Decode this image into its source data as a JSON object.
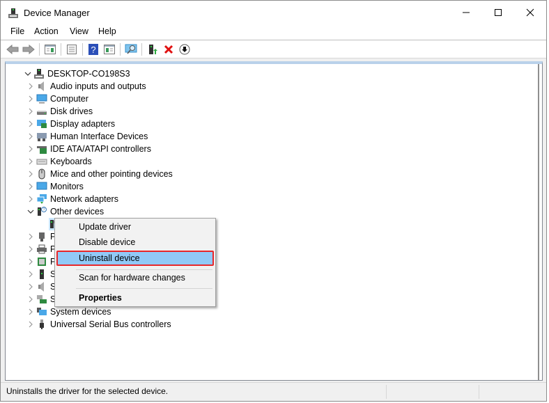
{
  "window": {
    "title": "Device Manager",
    "controls": [
      "minimize",
      "maximize",
      "close"
    ]
  },
  "menubar": {
    "items": [
      "File",
      "Action",
      "View",
      "Help"
    ]
  },
  "toolbar": {
    "buttons": [
      {
        "name": "back-icon"
      },
      {
        "name": "forward-icon"
      },
      {
        "name": "show-hide-console-tree-icon"
      },
      {
        "name": "properties-icon"
      },
      {
        "name": "help-icon"
      },
      {
        "name": "show-action-pane-icon"
      },
      {
        "name": "scan-hardware-icon"
      },
      {
        "name": "update-driver-icon"
      },
      {
        "name": "uninstall-icon"
      },
      {
        "name": "disable-device-icon"
      }
    ]
  },
  "tree": {
    "root": "DESKTOP-CO198S3",
    "items": [
      {
        "label": "Audio inputs and outputs",
        "icon": "audio-icon",
        "expanded": false
      },
      {
        "label": "Computer",
        "icon": "computer-icon",
        "expanded": false
      },
      {
        "label": "Disk drives",
        "icon": "disk-drive-icon",
        "expanded": false
      },
      {
        "label": "Display adapters",
        "icon": "display-adapter-icon",
        "expanded": false
      },
      {
        "label": "Human Interface Devices",
        "icon": "hid-icon",
        "expanded": false
      },
      {
        "label": "IDE ATA/ATAPI controllers",
        "icon": "ide-controller-icon",
        "expanded": false
      },
      {
        "label": "Keyboards",
        "icon": "keyboard-icon",
        "expanded": false
      },
      {
        "label": "Mice and other pointing devices",
        "icon": "mouse-icon",
        "expanded": false
      },
      {
        "label": "Monitors",
        "icon": "monitor-icon",
        "expanded": false
      },
      {
        "label": "Network adapters",
        "icon": "network-adapter-icon",
        "expanded": false
      },
      {
        "label": "Other devices",
        "icon": "other-devices-icon",
        "expanded": true
      },
      {
        "label": "",
        "icon": "unknown-device-icon",
        "child": true,
        "selected": true
      },
      {
        "label": "P",
        "icon": "ports-icon",
        "expanded": false
      },
      {
        "label": "P",
        "icon": "printer-icon",
        "expanded": false
      },
      {
        "label": "P",
        "icon": "processor-icon",
        "expanded": false
      },
      {
        "label": "S",
        "icon": "software-device-icon",
        "expanded": false
      },
      {
        "label": "S",
        "icon": "sound-icon",
        "expanded": false
      },
      {
        "label": "S",
        "icon": "storage-controller-icon",
        "expanded": false
      },
      {
        "label": "System devices",
        "icon": "system-devices-icon",
        "expanded": false
      },
      {
        "label": "Universal Serial Bus controllers",
        "icon": "usb-icon",
        "expanded": false
      }
    ]
  },
  "context_menu": {
    "items": [
      {
        "label": "Update driver"
      },
      {
        "label": "Disable device"
      },
      {
        "label": "Uninstall device",
        "highlighted": true
      },
      {
        "label": "Scan for hardware changes"
      },
      {
        "label": "Properties",
        "bold": true
      }
    ],
    "highlight_color": "#91c9f7",
    "annotation_color": "#e8272a"
  },
  "statusbar": {
    "text": "Uninstalls the driver for the selected device."
  }
}
